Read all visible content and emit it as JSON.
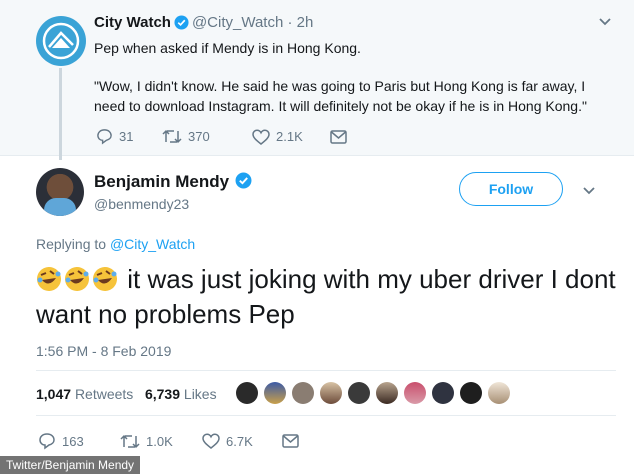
{
  "parent_tweet": {
    "name": "City Watch",
    "handle": "@City_Watch",
    "time": "2h",
    "text": "Pep when asked if Mendy is in Hong Kong.",
    "quote": "\"Wow, I didn't know. He said he was going to Paris but Hong Kong is far away, I need to download Instagram. It will definitely not be okay if he is in Hong Kong.\"",
    "replies": "31",
    "retweets": "370",
    "likes": "2.1K"
  },
  "main_tweet": {
    "name": "Benjamin Mendy",
    "handle": "@benmendy23",
    "follow_label": "Follow",
    "replying_prefix": "Replying to",
    "replying_to": "@City_Watch",
    "text": "it was just joking with my uber driver I dont want no problems Pep",
    "timestamp": "1:56 PM - 8 Feb 2019",
    "retweets_count": "1,047",
    "retweets_label": "Retweets",
    "likes_count": "6,739",
    "likes_label": "Likes",
    "replies": "163",
    "retweets": "1.0K",
    "likes": "6.7K"
  },
  "credit": "Twitter/Benjamin Mendy",
  "colors": {
    "accent": "#1da1f2",
    "muted": "#657786",
    "text": "#14171a"
  }
}
